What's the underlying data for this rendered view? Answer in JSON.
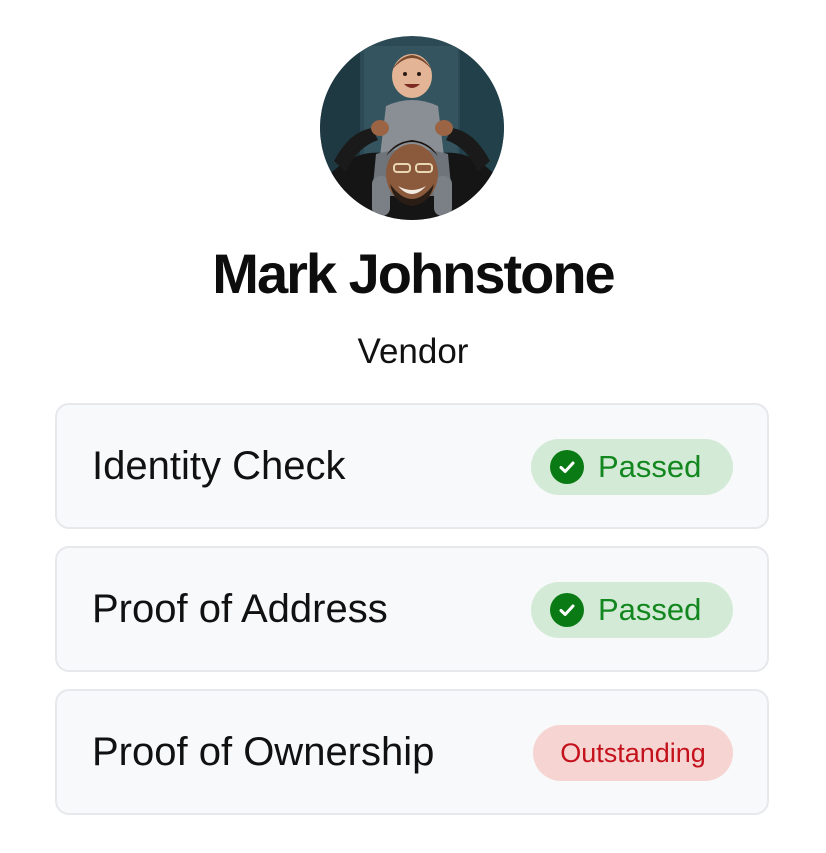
{
  "profile": {
    "name": "Mark Johnstone",
    "role": "Vendor",
    "avatar_icon": "profile-photo"
  },
  "checks": [
    {
      "label": "Identity Check",
      "status": "Passed",
      "status_type": "passed",
      "icon": "check-circle-icon"
    },
    {
      "label": "Proof of Address",
      "status": "Passed",
      "status_type": "passed",
      "icon": "check-circle-icon"
    },
    {
      "label": "Proof of Ownership",
      "status": "Outstanding",
      "status_type": "outstanding"
    }
  ],
  "colors": {
    "passed_bg": "#d3ebd6",
    "passed_text": "#13871f",
    "outstanding_bg": "#f6d4d2",
    "outstanding_text": "#c4121c",
    "card_bg": "#f8f9fb",
    "card_border": "#e6e8ec"
  }
}
